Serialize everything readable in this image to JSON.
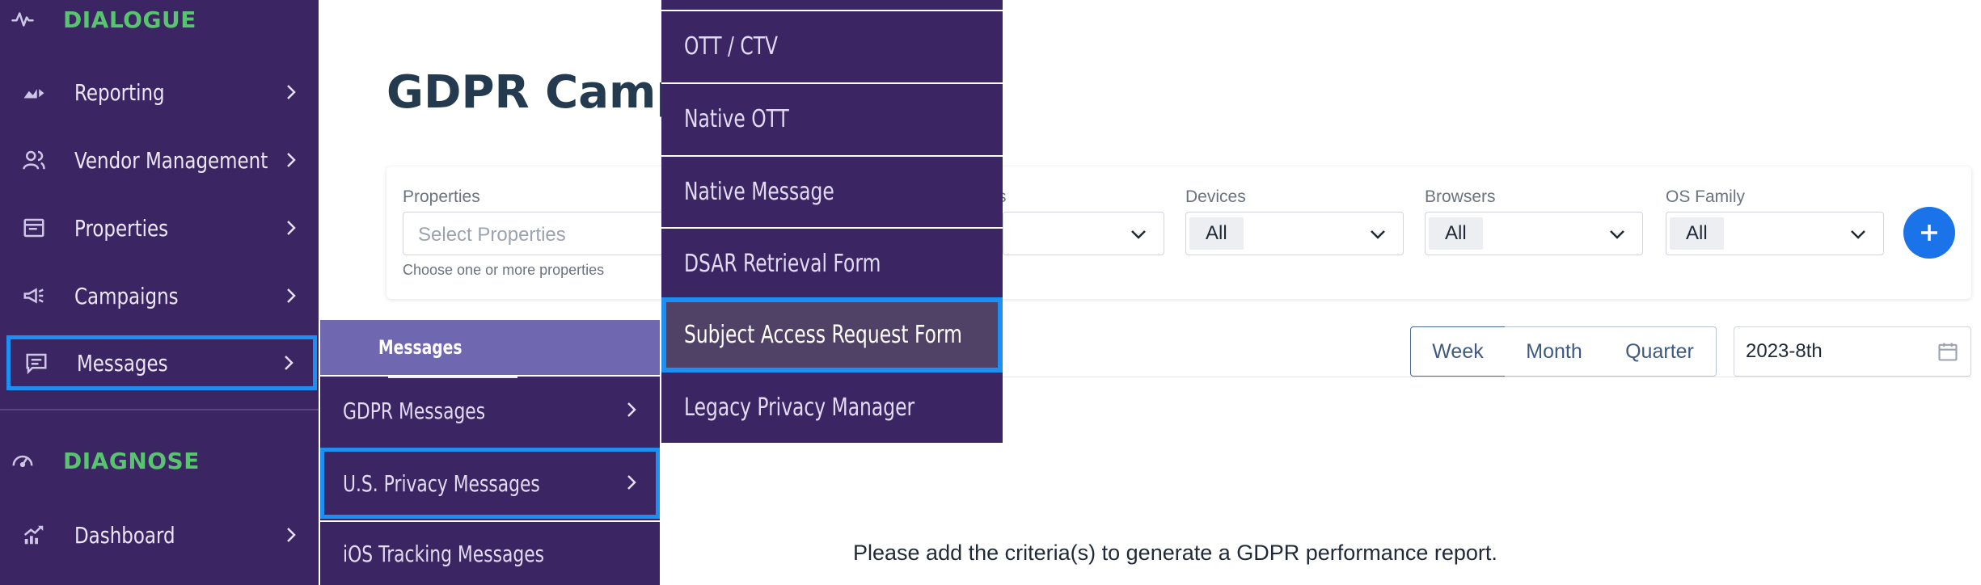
{
  "sidebar": {
    "sections": [
      {
        "label": "DIALOGUE",
        "icon": "activity-icon"
      },
      {
        "label": "DIAGNOSE",
        "icon": "gauge-icon"
      }
    ],
    "items": [
      {
        "label": "Reporting",
        "icon": "chart-icon"
      },
      {
        "label": "Vendor Management",
        "icon": "users-icon"
      },
      {
        "label": "Properties",
        "icon": "browser-window-icon"
      },
      {
        "label": "Campaigns",
        "icon": "megaphone-icon"
      },
      {
        "label": "Messages",
        "icon": "message-icon"
      },
      {
        "label": "Dashboard",
        "icon": "trending-icon"
      }
    ]
  },
  "main": {
    "title": "GDPR Campa",
    "filters": {
      "properties": {
        "label": "Properties",
        "placeholder": "Select Properties",
        "hint": "Choose one or more properties"
      },
      "partial_label": "s",
      "devices": {
        "label": "Devices",
        "value": "All"
      },
      "browsers": {
        "label": "Browsers",
        "value": "All"
      },
      "os_family": {
        "label": "OS Family",
        "value": "All"
      }
    },
    "periods": [
      "Week",
      "Month",
      "Quarter"
    ],
    "active_period": "Week",
    "date": "2023-8th",
    "empty_message": "Please add the criteria(s) to generate a GDPR performance report."
  },
  "flyout_messages": {
    "header": "Messages",
    "items": [
      "GDPR Messages",
      "U.S. Privacy Messages",
      "iOS Tracking Messages"
    ],
    "active": "U.S. Privacy Messages"
  },
  "flyout_us_privacy": {
    "items": [
      "OTT / CTV",
      "Native OTT",
      "Native Message",
      "DSAR Retrieval Form",
      "Subject Access Request Form",
      "Legacy Privacy Manager"
    ],
    "active": "Subject Access Request Form"
  },
  "colors": {
    "sidebar_bg": "#3b2562",
    "section_green": "#58c46f",
    "highlight_blue": "#1e8ff2",
    "flyout_header": "#6f68b0",
    "primary_button": "#1a73e8"
  }
}
